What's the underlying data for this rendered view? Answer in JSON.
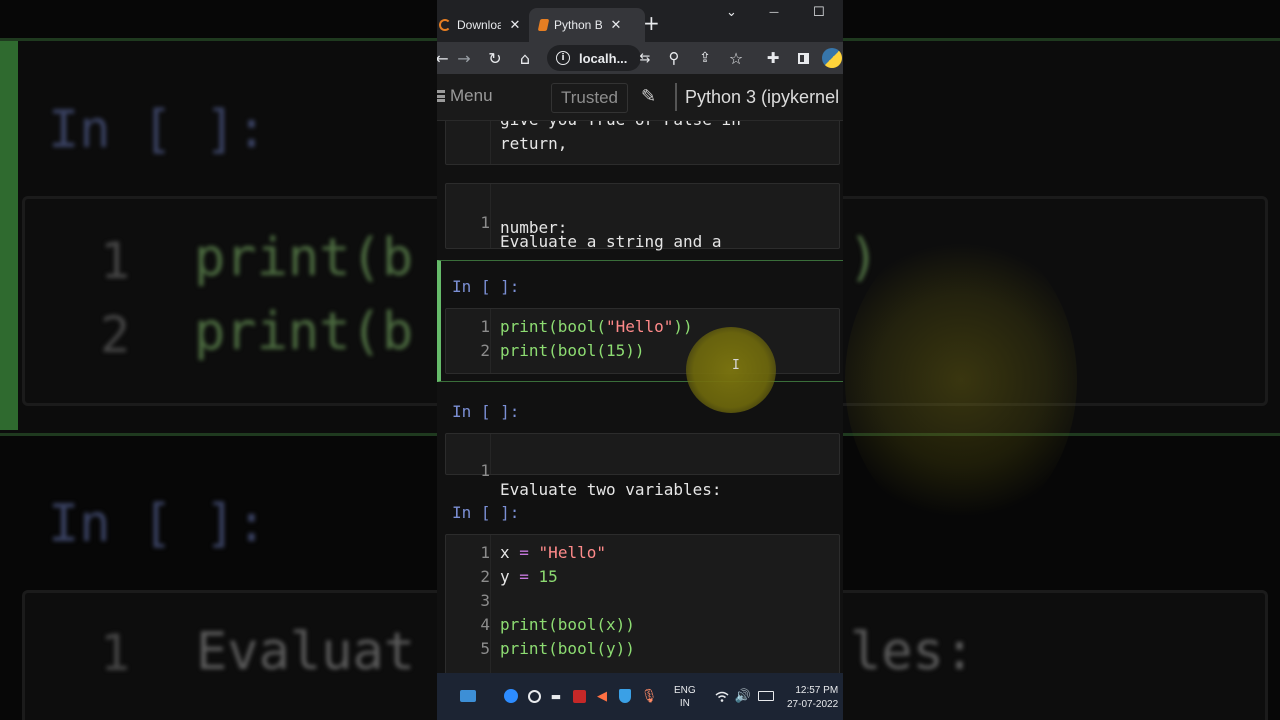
{
  "background": {
    "top_prompt": "In [ ]:",
    "code_line_numbers": [
      "1",
      "2"
    ],
    "code_lines": [
      "print(b",
      "print(b"
    ],
    "code_tail": ")",
    "mid_prompt": "In [ ]:",
    "bottom_line_number": "1",
    "bottom_text_left": "Evaluat",
    "bottom_text_right": "les:"
  },
  "browser": {
    "tabs": [
      {
        "label": "Downloa",
        "active": false
      },
      {
        "label": "Python B",
        "active": true
      }
    ],
    "new_tab_label": "+",
    "window_controls": {
      "collapse": "⌄",
      "minimize": "—",
      "maximize": "☐"
    },
    "address": "localh...",
    "toolbar_icons": [
      "back-icon",
      "forward-icon",
      "reload-icon",
      "home-icon",
      "info-icon",
      "translate-icon",
      "zoom-icon",
      "share-icon",
      "star-icon",
      "extensions-icon",
      "sidepanel-icon",
      "python-extension-icon"
    ]
  },
  "jupyter": {
    "menu_label": "Menu",
    "trusted_label": "Trusted",
    "kernel_label": "Python 3 (ipykernel"
  },
  "cells": {
    "md1": {
      "lines": [
        "give you True or False in",
        "return,"
      ]
    },
    "md2": {
      "line_numbers": [
        "1"
      ],
      "lines": [
        "Evaluate a string and a",
        "number:"
      ]
    },
    "code1": {
      "prompt": "In [ ]:",
      "line_numbers": [
        "1",
        "2"
      ],
      "tokens": [
        [
          {
            "t": "print(bool(",
            "c": "g"
          },
          {
            "t": "\"Hello\"",
            "c": "r"
          },
          {
            "t": "))",
            "c": "g"
          }
        ],
        [
          {
            "t": "print(bool(15))",
            "c": "g"
          }
        ]
      ]
    },
    "md3": {
      "prompt": "In [ ]:",
      "line_numbers": [
        "1"
      ],
      "lines": [
        "Evaluate two variables:"
      ]
    },
    "code2": {
      "prompt": "In [ ]:",
      "line_numbers": [
        "1",
        "2",
        "3",
        "4",
        "5"
      ],
      "tokens": [
        [
          {
            "t": "x ",
            "c": "w"
          },
          {
            "t": "=",
            "c": "p"
          },
          {
            "t": " ",
            "c": "w"
          },
          {
            "t": "\"Hello\"",
            "c": "r"
          }
        ],
        [
          {
            "t": "y ",
            "c": "w"
          },
          {
            "t": "=",
            "c": "p"
          },
          {
            "t": " ",
            "c": "w"
          },
          {
            "t": "15",
            "c": "g"
          }
        ],
        [],
        [
          {
            "t": "print(bool(x))",
            "c": "g"
          }
        ],
        [
          {
            "t": "print(bool(y))",
            "c": "g"
          }
        ]
      ]
    }
  },
  "taskbar": {
    "lang_top": "ENG",
    "lang_bottom": "IN",
    "time": "12:57 PM",
    "date": "27-07-2022"
  },
  "colors": {
    "green": "#8ddc72",
    "string": "#ff8a8a",
    "operator": "#c678dd",
    "prompt": "#7b8fd4",
    "selected_border": "#66bb6a"
  }
}
